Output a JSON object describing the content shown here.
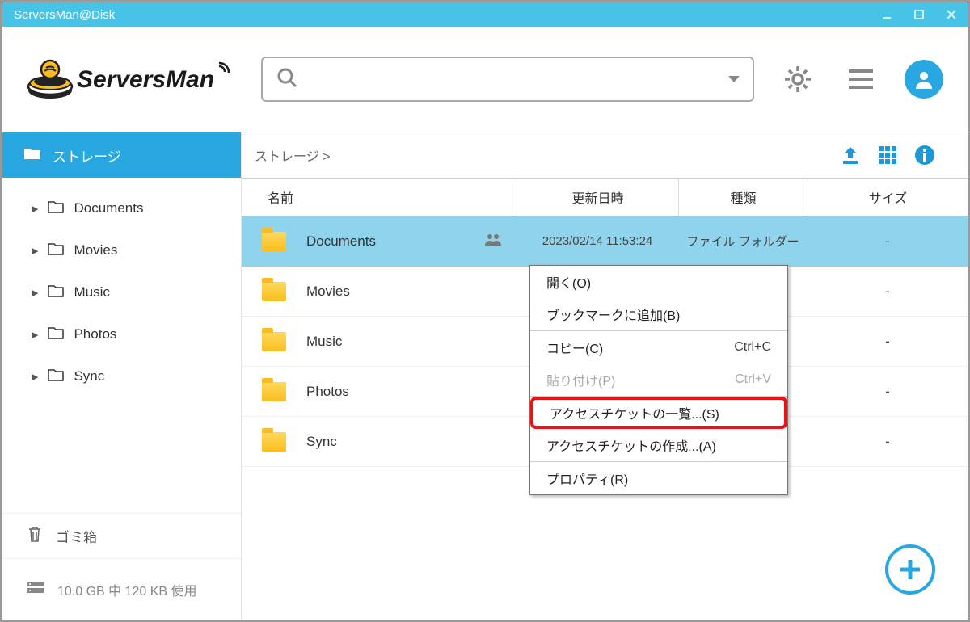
{
  "title": "ServersMan@Disk",
  "logo_text": "ServersMan",
  "search": {
    "placeholder": ""
  },
  "sidebar": {
    "header": "ストレージ",
    "items": [
      {
        "label": "Documents"
      },
      {
        "label": "Movies"
      },
      {
        "label": "Music"
      },
      {
        "label": "Photos"
      },
      {
        "label": "Sync"
      }
    ],
    "trash": "ゴミ箱",
    "storage": "10.0 GB 中 120 KB 使用"
  },
  "breadcrumb": "ストレージ >",
  "columns": {
    "name": "名前",
    "date": "更新日時",
    "kind": "種類",
    "size": "サイズ"
  },
  "rows": [
    {
      "name": "Documents",
      "date": "2023/02/14 11:53:24",
      "kind": "ファイル フォルダー",
      "size": "-",
      "shared": true
    },
    {
      "name": "Movies",
      "date": "",
      "kind": "",
      "size": "-"
    },
    {
      "name": "Music",
      "date": "",
      "kind": "",
      "size": "-"
    },
    {
      "name": "Photos",
      "date": "",
      "kind": "",
      "size": "-"
    },
    {
      "name": "Sync",
      "date": "",
      "kind": "",
      "size": "-"
    }
  ],
  "menu": {
    "open": "開く(O)",
    "bookmark": "ブックマークに追加(B)",
    "copy": "コピー(C)",
    "copy_sc": "Ctrl+C",
    "paste": "貼り付け(P)",
    "paste_sc": "Ctrl+V",
    "ticket_list": "アクセスチケットの一覧...(S)",
    "ticket_create": "アクセスチケットの作成...(A)",
    "properties": "プロパティ(R)"
  }
}
